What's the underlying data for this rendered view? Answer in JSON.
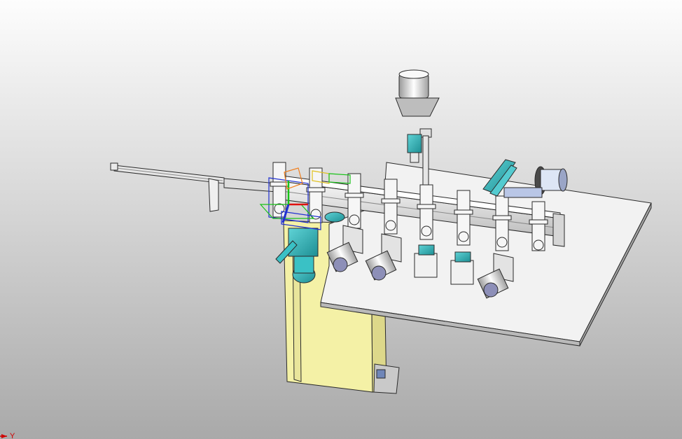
{
  "viewport": {
    "background_top": "#fdfdfd",
    "background_bottom": "#a9a9a9"
  },
  "model": {
    "colors": {
      "table_top": "#f2f2f2",
      "table_edge": "#b9b9b9",
      "frame": "#f4f1a6",
      "frame_shadow": "#ddd88a",
      "teal_part": "#2bb3b8",
      "steel": "#dcdcdc",
      "outline": "#2b2b2b"
    }
  },
  "axis_triad": {
    "label": "Y",
    "color": "#d00000"
  }
}
